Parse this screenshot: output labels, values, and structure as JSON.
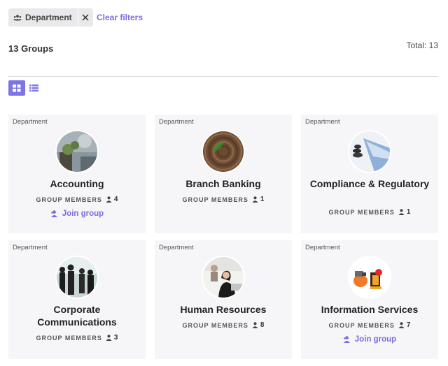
{
  "filters": {
    "chip_label": "Department",
    "clear_label": "Clear filters"
  },
  "summary": {
    "groups_count": "13 Groups",
    "total": "Total: 13"
  },
  "colors": {
    "accent": "#7a6de0",
    "card_bg": "#f6f6f9"
  },
  "cards": [
    {
      "type": "Department",
      "name": "Accounting",
      "members_label": "GROUP MEMBERS",
      "members": "4",
      "join": "Join group"
    },
    {
      "type": "Department",
      "name": "Branch Banking",
      "members_label": "GROUP MEMBERS",
      "members": "1"
    },
    {
      "type": "Department",
      "name": "Compliance & Regulatory",
      "members_label": "GROUP MEMBERS",
      "members": "1"
    },
    {
      "type": "Department",
      "name": "Corporate Communications",
      "members_label": "GROUP MEMBERS",
      "members": "3"
    },
    {
      "type": "Department",
      "name": "Human Resources",
      "members_label": "GROUP MEMBERS",
      "members": "8"
    },
    {
      "type": "Department",
      "name": "Information Services",
      "members_label": "GROUP MEMBERS",
      "members": "7",
      "join": "Join group"
    }
  ]
}
